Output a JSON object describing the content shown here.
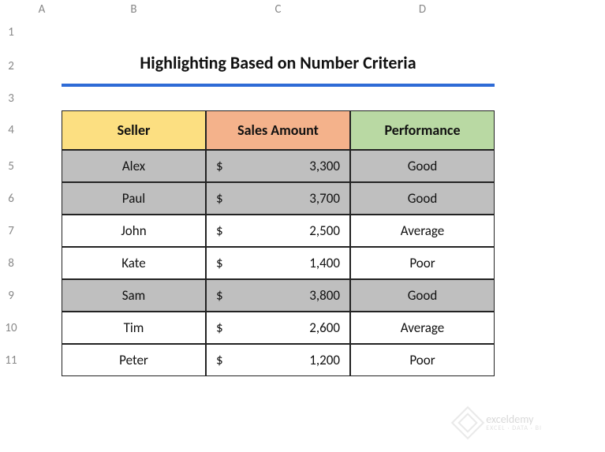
{
  "column_headers": [
    "A",
    "B",
    "C",
    "D"
  ],
  "row_headers": [
    "1",
    "2",
    "3",
    "4",
    "5",
    "6",
    "7",
    "8",
    "9",
    "10",
    "11"
  ],
  "title": "Highlighting Based on Number Criteria",
  "table": {
    "headers": {
      "seller": "Seller",
      "sales": "Sales Amount",
      "performance": "Performance"
    },
    "currency_symbol": "$",
    "rows": [
      {
        "seller": "Alex",
        "sales": "3,300",
        "performance": "Good",
        "highlight": true
      },
      {
        "seller": "Paul",
        "sales": "3,700",
        "performance": "Good",
        "highlight": true
      },
      {
        "seller": "John",
        "sales": "2,500",
        "performance": "Average",
        "highlight": false
      },
      {
        "seller": "Kate",
        "sales": "1,400",
        "performance": "Poor",
        "highlight": false
      },
      {
        "seller": "Sam",
        "sales": "3,800",
        "performance": "Good",
        "highlight": true
      },
      {
        "seller": "Tim",
        "sales": "2,600",
        "performance": "Average",
        "highlight": false
      },
      {
        "seller": "Peter",
        "sales": "1,200",
        "performance": "Poor",
        "highlight": false
      }
    ]
  },
  "watermark": {
    "brand": "exceldemy",
    "tagline": "EXCEL · DATA · BI"
  }
}
